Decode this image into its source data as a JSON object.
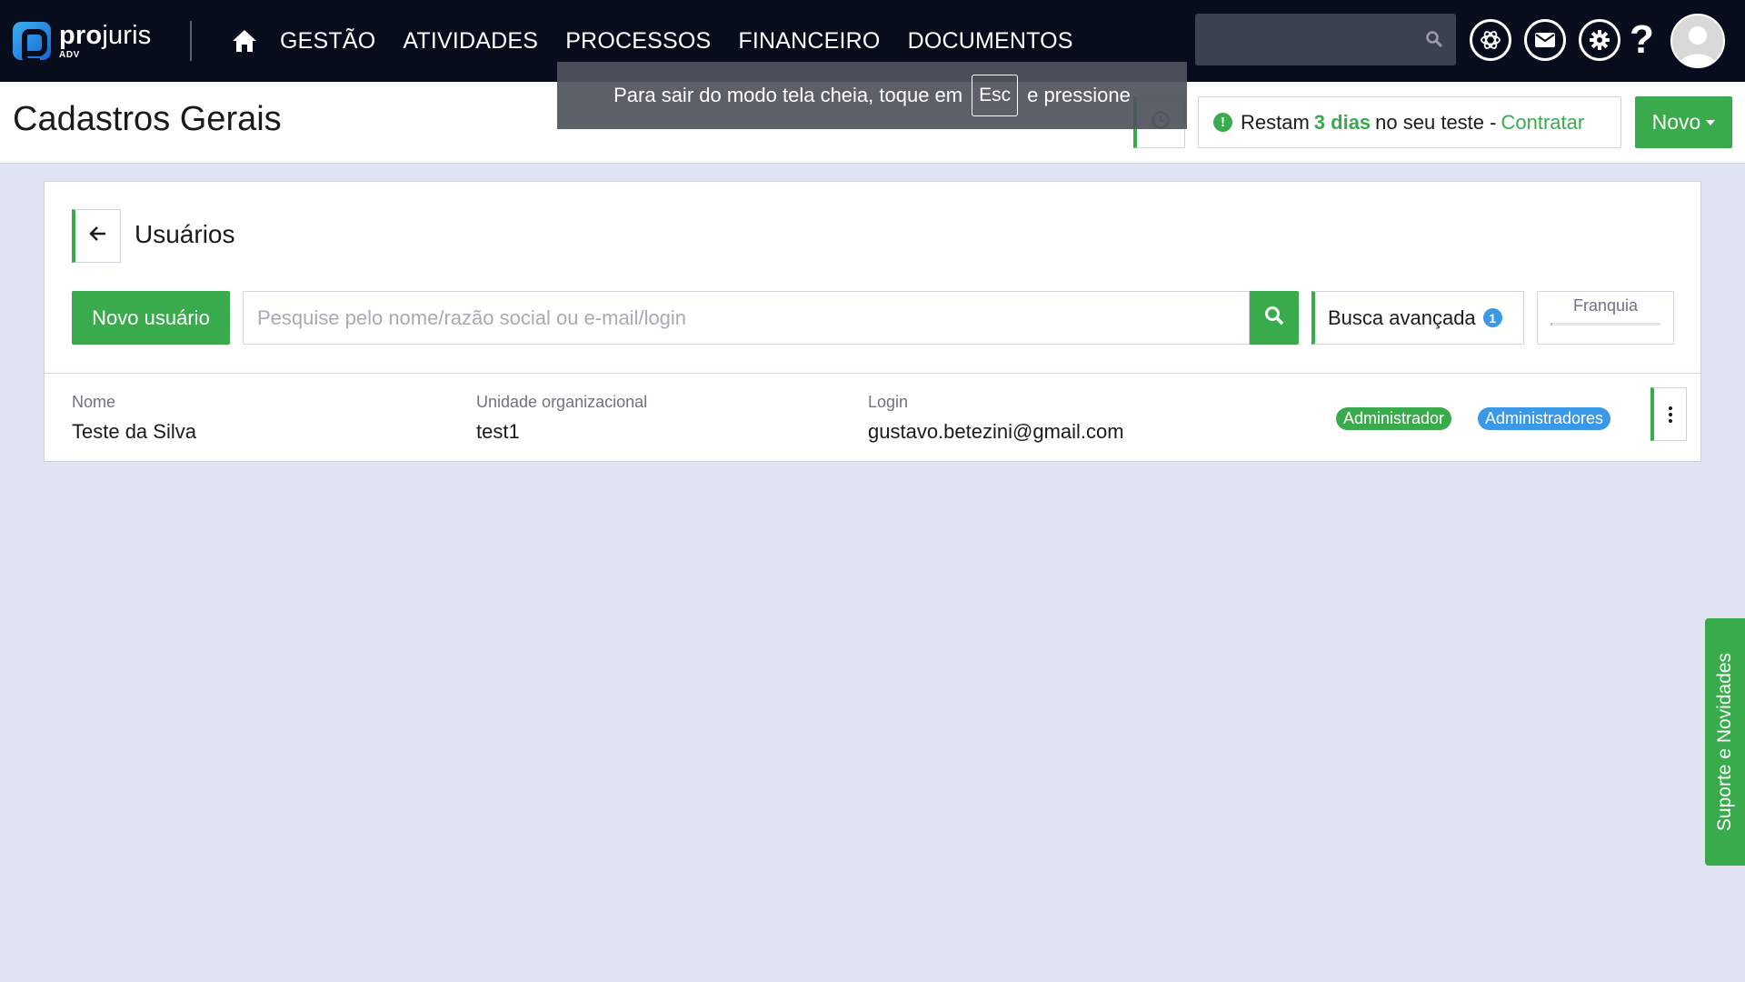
{
  "topbar": {
    "logo": {
      "name_bold": "pro",
      "name_rest": "juris",
      "sub": "ADV"
    },
    "nav": [
      "GESTÃO",
      "ATIVIDADES",
      "PROCESSOS",
      "FINANCEIRO",
      "DOCUMENTOS"
    ],
    "help_label": "?"
  },
  "fullscreen_toast": {
    "text_before": "Para sair do modo tela cheia, toque em",
    "key": "Esc",
    "text_after": "e pressione"
  },
  "header": {
    "title": "Cadastros Gerais",
    "trial": {
      "alert_glyph": "!",
      "prefix": "Restam",
      "days": "3 dias",
      "suffix": "no seu teste -",
      "link": "Contratar"
    },
    "new_button": "Novo"
  },
  "users_panel": {
    "title": "Usuários",
    "new_user_button": "Novo usuário",
    "search_placeholder": "Pesquise pelo nome/razão social ou e-mail/login",
    "search_value": "",
    "advanced_search": {
      "label": "Busca avançada",
      "count": "1"
    },
    "franchise_label": "Franquia",
    "columns": {
      "name": "Nome",
      "unit": "Unidade organizacional",
      "login": "Login"
    },
    "rows": [
      {
        "name": "Teste da Silva",
        "unit": "test1",
        "login": "gustavo.betezini@gmail.com",
        "tags": [
          "Administrador",
          "Administradores"
        ]
      }
    ]
  },
  "support_tab": "Suporte e Novidades",
  "colors": {
    "navbar": "#070d1c",
    "accent_green": "#3aab4d",
    "badge_blue": "#3a98e8",
    "page_bg": "#e1e4f2"
  },
  "icons": [
    "home-icon",
    "search-icon",
    "openai-icon",
    "mail-icon",
    "gear-icon",
    "help-icon",
    "avatar",
    "history-icon",
    "alert-icon",
    "back-arrow-icon",
    "kebab-icon"
  ]
}
